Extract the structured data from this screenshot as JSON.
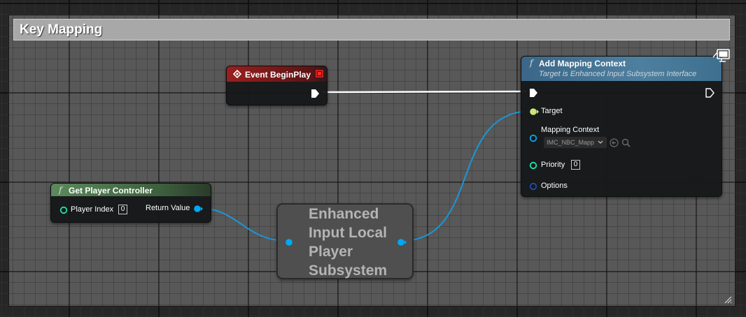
{
  "comment": {
    "title": "Key Mapping"
  },
  "nodes": {
    "event_begin_play": {
      "title": "Event BeginPlay"
    },
    "get_player_controller": {
      "title": "Get Player Controller",
      "player_index_label": "Player Index",
      "player_index_value": "0",
      "return_value_label": "Return Value"
    },
    "enhanced_input_subsystem": {
      "title": "Enhanced Input Local Player Subsystem"
    },
    "add_mapping_context": {
      "title": "Add Mapping Context",
      "subtitle": "Target is Enhanced Input Subsystem Interface",
      "target_label": "Target",
      "mapping_context_label": "Mapping Context",
      "mapping_context_value": "IMC_NBC_Mapp",
      "priority_label": "Priority",
      "priority_value": "0",
      "options_label": "Options"
    }
  },
  "colors": {
    "exec": "#ffffff",
    "object_pin": "#00a8f4",
    "int_pin": "#1fe3a8",
    "target_pin": "#c8e878",
    "event_header": "#8f1e1e",
    "pure_function_header": "#4e7a4e",
    "function_header": "#3f6f8f"
  }
}
